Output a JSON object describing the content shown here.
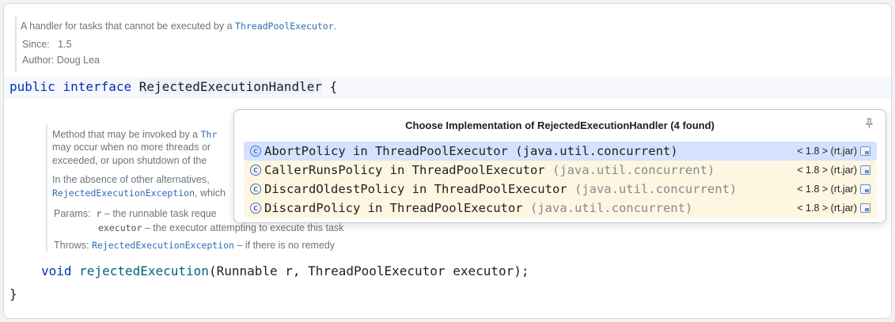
{
  "class_doc": {
    "description_prefix": "A handler for tasks that cannot be executed by a ",
    "description_link": "ThreadPoolExecutor",
    "description_suffix": ".",
    "since_label": "Since:",
    "since_value": "1.5",
    "author_label": "Author:",
    "author_value": "Doug Lea"
  },
  "declaration": {
    "kw_public": "public",
    "kw_interface": "interface",
    "name": "RejectedExecutionHandler",
    "brace_open": "{",
    "brace_close": "}"
  },
  "method_doc": {
    "line1": "Method that may be invoked by a ",
    "line1_link": "Thr",
    "line2": "may occur when no more threads or",
    "line3": "exceeded, or upon shutdown of the",
    "line4": "In the absence of other alternatives,",
    "line5_link": "RejectedExecutionException",
    "line5_suffix": ", which",
    "params_label": "Params:",
    "param1_name": "r",
    "param1_desc": " – the runnable task reque",
    "param2_name": "executor",
    "param2_desc": " – the executor attempting to execute this task",
    "throws_label": "Throws:",
    "throws_link": "RejectedExecutionException",
    "throws_desc": " – if there is no remedy"
  },
  "method": {
    "kw_void": "void",
    "name": "rejectedExecution",
    "params": "(Runnable r, ThreadPoolExecutor executor);"
  },
  "popup": {
    "title": "Choose Implementation of RejectedExecutionHandler (4 found)",
    "pin_icon": "pin-icon",
    "items": [
      {
        "name": "AbortPolicy in ThreadPoolExecutor",
        "package": " (java.util.concurrent)",
        "location": "< 1.8 > (rt.jar)"
      },
      {
        "name": "CallerRunsPolicy in ThreadPoolExecutor",
        "package": " (java.util.concurrent)",
        "location": "< 1.8 > (rt.jar)"
      },
      {
        "name": "DiscardOldestPolicy in ThreadPoolExecutor",
        "package": " (java.util.concurrent)",
        "location": "< 1.8 > (rt.jar)"
      },
      {
        "name": "DiscardPolicy in ThreadPoolExecutor",
        "package": " (java.util.concurrent)",
        "location": "< 1.8 > (rt.jar)"
      }
    ]
  },
  "colors": {
    "keyword": "#0033b3",
    "method_name": "#00627a",
    "selection": "#d4e2ff",
    "alt_row": "#fdf6e1"
  }
}
